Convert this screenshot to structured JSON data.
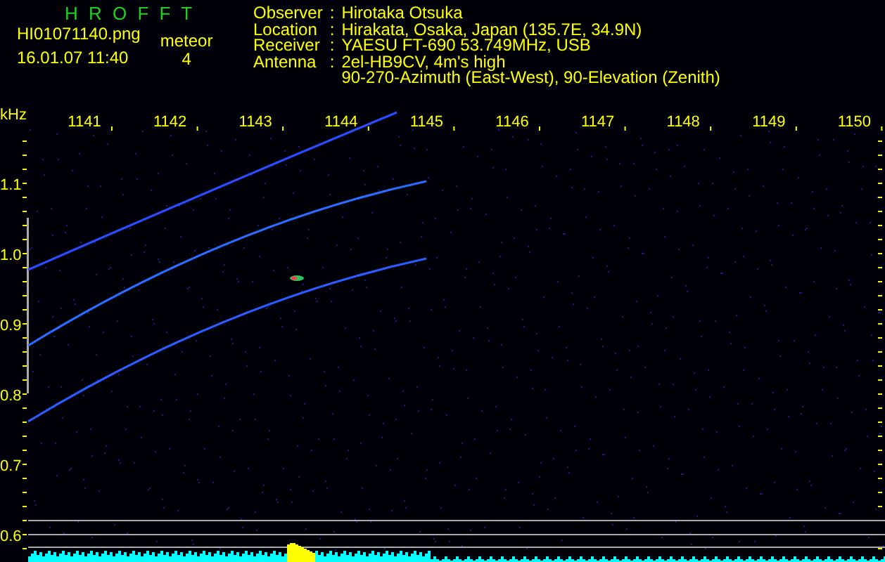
{
  "header": {
    "title": "H R O F F T",
    "filename": "HI01071140.png",
    "timestamp": "16.01.07 11:40",
    "count_label": "meteor",
    "count": "4"
  },
  "info": [
    {
      "label": "Observer",
      "separator": ":",
      "lines": [
        "Hirotaka Otsuka"
      ]
    },
    {
      "label": "Location",
      "separator": ":",
      "lines": [
        "Hirakata, Osaka, Japan (135.7E, 34.9N)"
      ]
    },
    {
      "label": "Receiver",
      "separator": ":",
      "lines": [
        "YAESU FT-690 53.749MHz, USB"
      ]
    },
    {
      "label": "Antenna",
      "separator": ":",
      "lines": [
        "2el-HB9CV, 4m's high",
        "90-270-Azimuth (East-West), 90-Elevation (Zenith)"
      ]
    }
  ],
  "spectrogram": {
    "unit_label": "kHz",
    "x_labels": [
      "1141",
      "1142",
      "1143",
      "1144",
      "1145",
      "1146",
      "1147",
      "1148",
      "1149",
      "1150"
    ],
    "y_labels": [
      "1.1",
      "1.0",
      "0.9",
      "0.8",
      "0.7",
      "0.6"
    ]
  }
}
